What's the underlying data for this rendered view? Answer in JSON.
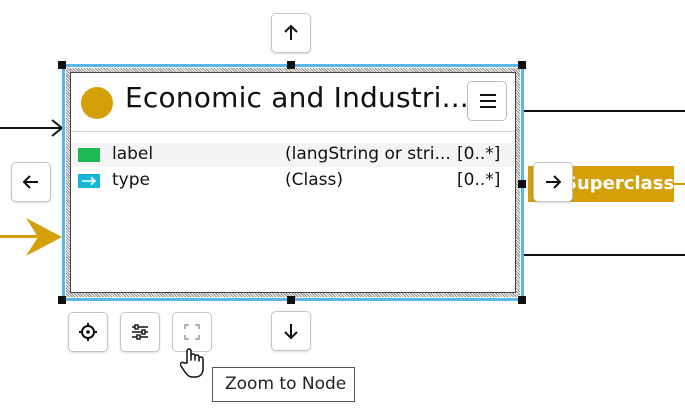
{
  "node": {
    "title": "Economic and Industri...",
    "dot_color": "#d4a00a",
    "rows": [
      {
        "name": "label",
        "range": "(langString or stri...",
        "cardinality": "[0..*]",
        "icon": "green-rect-icon",
        "icon_color": "#1db954"
      },
      {
        "name": "type",
        "range": "(Class)",
        "cardinality": "[0..*]",
        "icon": "cyan-arrow-icon",
        "icon_color": "#16b6d6"
      }
    ]
  },
  "superclasses": {
    "label": "Superclasses",
    "color": "#d4a00a"
  },
  "tooltip": {
    "text": "Zoom to Node"
  },
  "selection_color": "#58b6e8"
}
